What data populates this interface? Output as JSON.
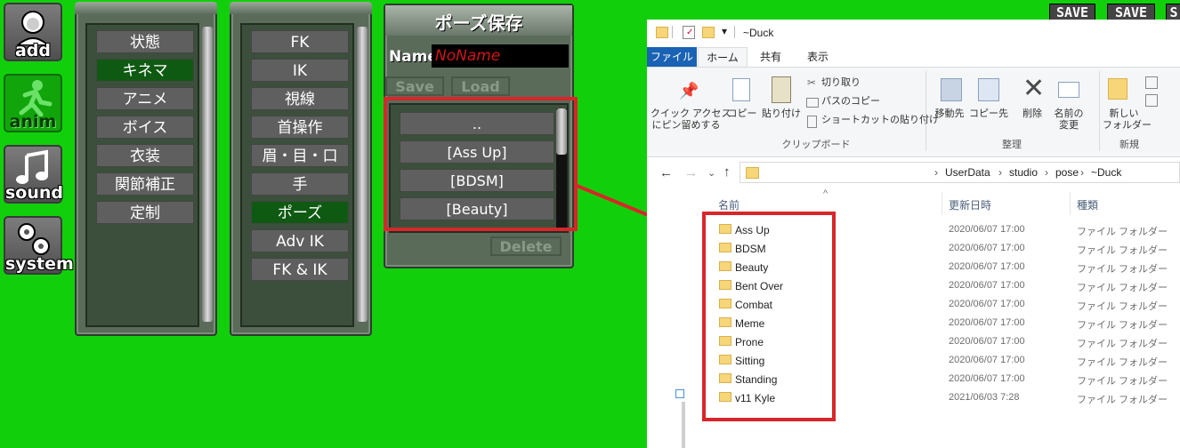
{
  "sidebar": {
    "add_label": "add",
    "anim_label": "anim",
    "sound_label": "sound",
    "system_label": "system"
  },
  "category_menu": {
    "items": [
      "状態",
      "キネマ",
      "アニメ",
      "ボイス",
      "衣装",
      "関節補正",
      "定制"
    ],
    "selected": "キネマ"
  },
  "kinematics_menu": {
    "items": [
      "FK",
      "IK",
      "視線",
      "首操作",
      "眉・目・口",
      "手",
      "ポーズ",
      "Adv IK",
      "FK & IK"
    ],
    "selected": "ポーズ"
  },
  "pose_panel": {
    "title": "ポーズ保存",
    "name_label": "Name",
    "name_value": "NoName",
    "save_label": "Save",
    "load_label": "Load",
    "delete_label": "Delete",
    "list": [
      "..",
      "[Ass Up]",
      "[BDSM]",
      "[Beauty]"
    ]
  },
  "top_right": {
    "save1": "SAVE",
    "save2": "SAVE",
    "save3": "S"
  },
  "explorer": {
    "title": "~Duck",
    "tabs": [
      "ファイル",
      "ホーム",
      "共有",
      "表示"
    ],
    "ribbon": {
      "pin": "クイック アクセス\nにピン留めする",
      "copy": "コピー",
      "paste": "貼り付け",
      "cut": "切り取り",
      "copy_path": "パスのコピー",
      "paste_shortcut": "ショートカットの貼り付け",
      "clipboard_group": "クリップボード",
      "move_to": "移動先",
      "copy_to": "コピー先",
      "delete": "削除",
      "rename": "名前の\n変更",
      "organize_group": "整理",
      "new_folder": "新しい\nフォルダー",
      "new_group": "新規"
    },
    "path": [
      "UserData",
      "studio",
      "pose",
      "~Duck"
    ],
    "columns": {
      "name": "名前",
      "date": "更新日時",
      "type": "種類"
    },
    "files": [
      {
        "name": "Ass Up",
        "date": "2020/06/07 17:00",
        "type": "ファイル フォルダー"
      },
      {
        "name": "BDSM",
        "date": "2020/06/07 17:00",
        "type": "ファイル フォルダー"
      },
      {
        "name": "Beauty",
        "date": "2020/06/07 17:00",
        "type": "ファイル フォルダー"
      },
      {
        "name": "Bent Over",
        "date": "2020/06/07 17:00",
        "type": "ファイル フォルダー"
      },
      {
        "name": "Combat",
        "date": "2020/06/07 17:00",
        "type": "ファイル フォルダー"
      },
      {
        "name": "Meme",
        "date": "2020/06/07 17:00",
        "type": "ファイル フォルダー"
      },
      {
        "name": "Prone",
        "date": "2020/06/07 17:00",
        "type": "ファイル フォルダー"
      },
      {
        "name": "Sitting",
        "date": "2020/06/07 17:00",
        "type": "ファイル フォルダー"
      },
      {
        "name": "Standing",
        "date": "2020/06/07 17:00",
        "type": "ファイル フォルダー"
      },
      {
        "name": "v11 Kyle",
        "date": "2021/06/03 7:28",
        "type": "ファイル フォルダー"
      }
    ]
  },
  "colors": {
    "background": "#11d00b",
    "highlight": "#d8262a",
    "selected_menu": "#0f5a12"
  }
}
